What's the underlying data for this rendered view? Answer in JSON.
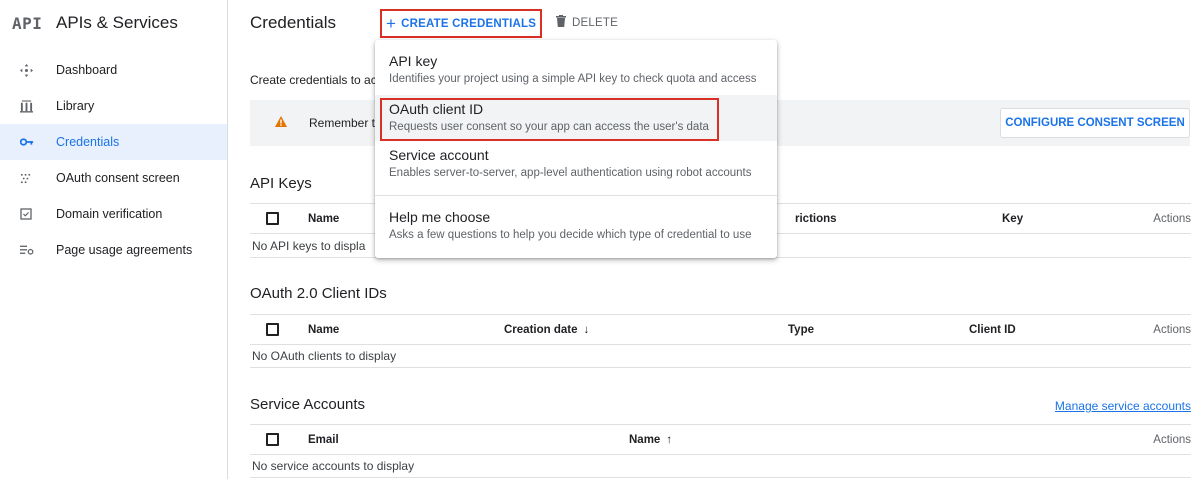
{
  "sidebar": {
    "logo": "API",
    "title": "APIs & Services",
    "items": [
      {
        "label": "Dashboard",
        "icon": "dashboard-icon"
      },
      {
        "label": "Library",
        "icon": "library-icon"
      },
      {
        "label": "Credentials",
        "icon": "key-icon",
        "active": true
      },
      {
        "label": "OAuth consent screen",
        "icon": "consent-icon"
      },
      {
        "label": "Domain verification",
        "icon": "domain-icon"
      },
      {
        "label": "Page usage agreements",
        "icon": "settings-list-icon"
      }
    ]
  },
  "header": {
    "title": "Credentials",
    "create_label": "CREATE CREDENTIALS",
    "delete_label": "DELETE"
  },
  "main": {
    "intro": "Create credentials to ac",
    "banner_text": "Remember t",
    "consent_button": "CONFIGURE CONSENT SCREEN",
    "api_keys": {
      "title": "API Keys",
      "columns": [
        "Name",
        "rictions",
        "Key",
        "Actions"
      ],
      "empty": "No API keys to displa"
    },
    "oauth": {
      "title": "OAuth 2.0 Client IDs",
      "columns": [
        "Name",
        "Creation date",
        "Type",
        "Client ID",
        "Actions"
      ],
      "empty": "No OAuth clients to display"
    },
    "service_accounts": {
      "title": "Service Accounts",
      "manage_link": "Manage service accounts",
      "columns": [
        "Email",
        "Name",
        "Actions"
      ],
      "empty": "No service accounts to display"
    }
  },
  "menu": {
    "items": [
      {
        "title": "API key",
        "desc": "Identifies your project using a simple API key to check quota and access"
      },
      {
        "title": "OAuth client ID",
        "desc": "Requests user consent so your app can access the user's data"
      },
      {
        "title": "Service account",
        "desc": "Enables server-to-server, app-level authentication using robot accounts"
      },
      {
        "title": "Help me choose",
        "desc": "Asks a few questions to help you decide which type of credential to use"
      }
    ]
  },
  "colors": {
    "accent": "#1a73e8",
    "highlight": "#d93025",
    "warning": "#e37400"
  }
}
